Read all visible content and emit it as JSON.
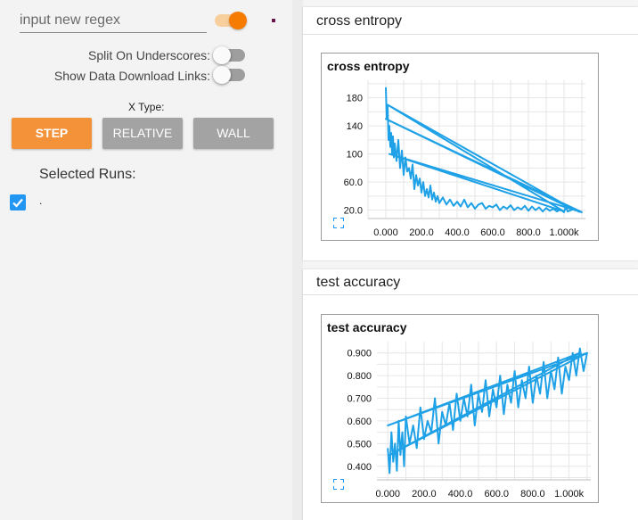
{
  "sidebar": {
    "regex_placeholder": "input new regex",
    "regex_toggle_on": true,
    "split_underscores_label": "Split On Underscores:",
    "show_download_label": "Show Data Download Links:",
    "xtype_label": "X Type:",
    "xtype_buttons": [
      "STEP",
      "RELATIVE",
      "WALL"
    ],
    "xtype_selected": "STEP",
    "selected_runs_label": "Selected Runs:",
    "runs": [
      {
        "name": ".",
        "checked": true
      }
    ]
  },
  "colors": {
    "accent": "#f57c00",
    "series": "#1ea1e6",
    "checkbox": "#2196f3"
  },
  "cards": [
    {
      "title": "cross entropy"
    },
    {
      "title": "test accuracy"
    }
  ],
  "chart_data": [
    {
      "type": "line",
      "title": "cross entropy",
      "xlabel": "",
      "ylabel": "",
      "xlim": [
        -100,
        1120
      ],
      "ylim": [
        8,
        205
      ],
      "xticks": [
        "0.000",
        "200.0",
        "400.0",
        "600.0",
        "800.0",
        "1.000k"
      ],
      "xtick_values": [
        0,
        200,
        400,
        600,
        800,
        1000
      ],
      "yticks": [
        "20.0",
        "60.0",
        "100",
        "140",
        "180"
      ],
      "ytick_values": [
        20,
        60,
        100,
        140,
        180
      ],
      "grid": true,
      "series": [
        {
          "x": [
            0,
            5,
            10,
            15,
            20,
            25,
            30,
            35,
            40,
            45,
            50,
            60,
            70,
            80,
            90,
            100,
            110,
            120,
            130,
            140,
            150,
            160,
            170,
            180,
            190,
            200,
            210,
            220,
            230,
            240,
            250,
            260,
            270,
            280,
            290,
            300,
            320,
            340,
            360,
            380,
            400,
            420,
            440,
            460,
            480,
            500,
            520,
            540,
            560,
            580,
            600,
            620,
            640,
            660,
            680,
            700,
            720,
            740,
            760,
            780,
            800,
            820,
            840,
            860,
            880,
            900,
            920,
            940,
            960,
            980,
            1000,
            1010,
            1020,
            1040,
            1060,
            1080,
            1100,
            0,
            1060,
            10,
            1000,
            20,
            1100
          ],
          "y": [
            195,
            150,
            170,
            120,
            140,
            110,
            130,
            100,
            125,
            95,
            115,
            90,
            120,
            80,
            105,
            70,
            95,
            75,
            80,
            65,
            85,
            50,
            70,
            55,
            65,
            45,
            60,
            40,
            50,
            38,
            55,
            35,
            45,
            32,
            40,
            30,
            38,
            28,
            35,
            26,
            32,
            25,
            35,
            24,
            30,
            22,
            28,
            30,
            22,
            26,
            24,
            28,
            20,
            25,
            22,
            27,
            20,
            24,
            21,
            26,
            19,
            25,
            20,
            24,
            18,
            23,
            19,
            22,
            18,
            21,
            17,
            25,
            18,
            20,
            22,
            18,
            17,
            150,
            20,
            170,
            18,
            100,
            17
          ]
        }
      ]
    },
    {
      "type": "line",
      "title": "test accuracy",
      "xlabel": "",
      "ylabel": "",
      "xlim": [
        -60,
        1120
      ],
      "ylim": [
        0.34,
        0.95
      ],
      "xticks": [
        "0.000",
        "200.0",
        "400.0",
        "600.0",
        "800.0",
        "1.000k"
      ],
      "xtick_values": [
        0,
        200,
        400,
        600,
        800,
        1000
      ],
      "yticks": [
        "0.400",
        "0.500",
        "0.600",
        "0.700",
        "0.800",
        "0.900"
      ],
      "ytick_values": [
        0.4,
        0.5,
        0.6,
        0.7,
        0.8,
        0.9
      ],
      "grid": true,
      "series": [
        {
          "x": [
            0,
            10,
            20,
            30,
            40,
            50,
            60,
            70,
            80,
            90,
            100,
            120,
            140,
            160,
            180,
            200,
            220,
            240,
            260,
            280,
            300,
            320,
            340,
            360,
            380,
            400,
            420,
            440,
            460,
            480,
            500,
            520,
            540,
            560,
            580,
            600,
            620,
            640,
            660,
            680,
            700,
            720,
            740,
            760,
            780,
            800,
            820,
            840,
            860,
            880,
            900,
            920,
            940,
            960,
            980,
            1000,
            1020,
            1040,
            1060,
            1080,
            1100,
            0,
            1060,
            10,
            1100
          ],
          "y": [
            0.48,
            0.37,
            0.55,
            0.42,
            0.5,
            0.38,
            0.6,
            0.45,
            0.55,
            0.4,
            0.62,
            0.5,
            0.58,
            0.48,
            0.66,
            0.52,
            0.6,
            0.55,
            0.7,
            0.5,
            0.64,
            0.58,
            0.68,
            0.56,
            0.72,
            0.6,
            0.7,
            0.62,
            0.76,
            0.58,
            0.72,
            0.64,
            0.78,
            0.62,
            0.74,
            0.66,
            0.8,
            0.63,
            0.76,
            0.68,
            0.82,
            0.66,
            0.78,
            0.7,
            0.84,
            0.68,
            0.8,
            0.72,
            0.86,
            0.7,
            0.82,
            0.74,
            0.88,
            0.72,
            0.84,
            0.78,
            0.9,
            0.8,
            0.92,
            0.82,
            0.9,
            0.58,
            0.9,
            0.45,
            0.9
          ]
        }
      ]
    }
  ]
}
